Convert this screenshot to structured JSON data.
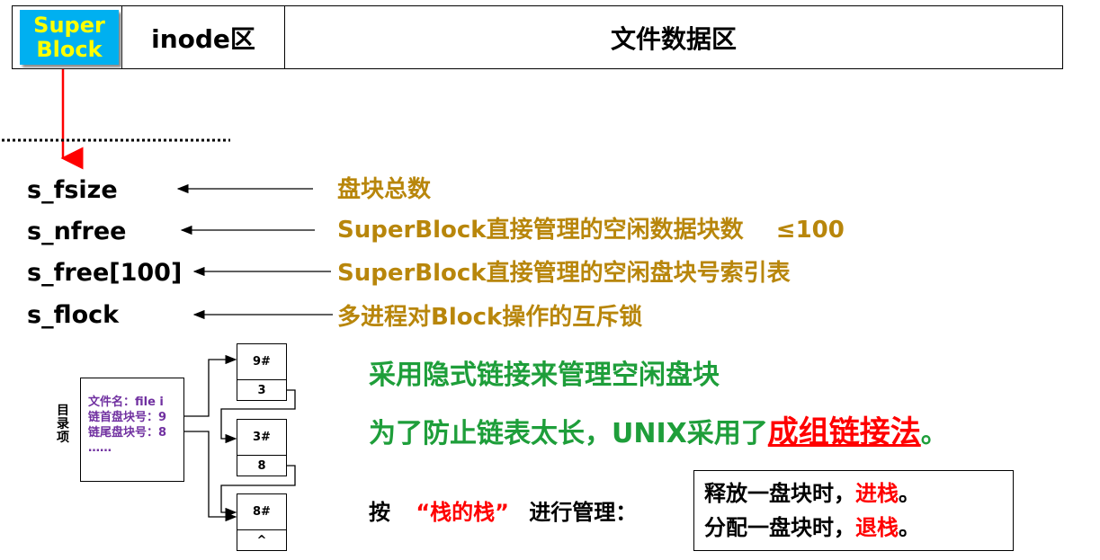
{
  "header": {
    "superblock": [
      "Super",
      "Block"
    ],
    "inode": "inode区",
    "file_data": "文件数据区"
  },
  "fields": [
    {
      "name": "s_fsize",
      "desc": "盘块总数"
    },
    {
      "name": "s_nfree",
      "desc": "SuperBlock直接管理的空闲数据块数    ≤100"
    },
    {
      "name": "s_free[100]",
      "desc": "SuperBlock直接管理的空闲盘块号索引表"
    },
    {
      "name": "s_flock",
      "desc": "多进程对Block操作的互斥锁"
    }
  ],
  "directory": {
    "label": [
      "目",
      "录",
      "项"
    ],
    "lines": [
      "文件名：file i",
      "链首盘块号：9",
      "链尾盘块号：8",
      "……"
    ]
  },
  "blocks": [
    {
      "id": "9#",
      "next": "3"
    },
    {
      "id": "3#",
      "next": "8"
    },
    {
      "id": "8#",
      "next": "^"
    }
  ],
  "notes": {
    "implicit": "采用隐式链接来管理空闲盘块",
    "prefix": "为了防止链表太长，UNIX采用了",
    "method": "成组链接法",
    "suffix": "。"
  },
  "stack": {
    "manage_prefix": "按",
    "manage_quote": "“栈的栈”",
    "manage_suffix": "进行管理：",
    "release_prefix": "释放一盘块时，",
    "release_action": "进栈",
    "release_end": "。",
    "alloc_prefix": "分配一盘块时，",
    "alloc_action": "退栈",
    "alloc_end": "。"
  },
  "colors": {
    "accent_green": "#1e9e3a",
    "desc_gold": "#b8860b",
    "red": "#ff0000",
    "sb_blue": "#00b0f0",
    "sb_yellow": "#ffff00",
    "purple": "#7030a0"
  }
}
